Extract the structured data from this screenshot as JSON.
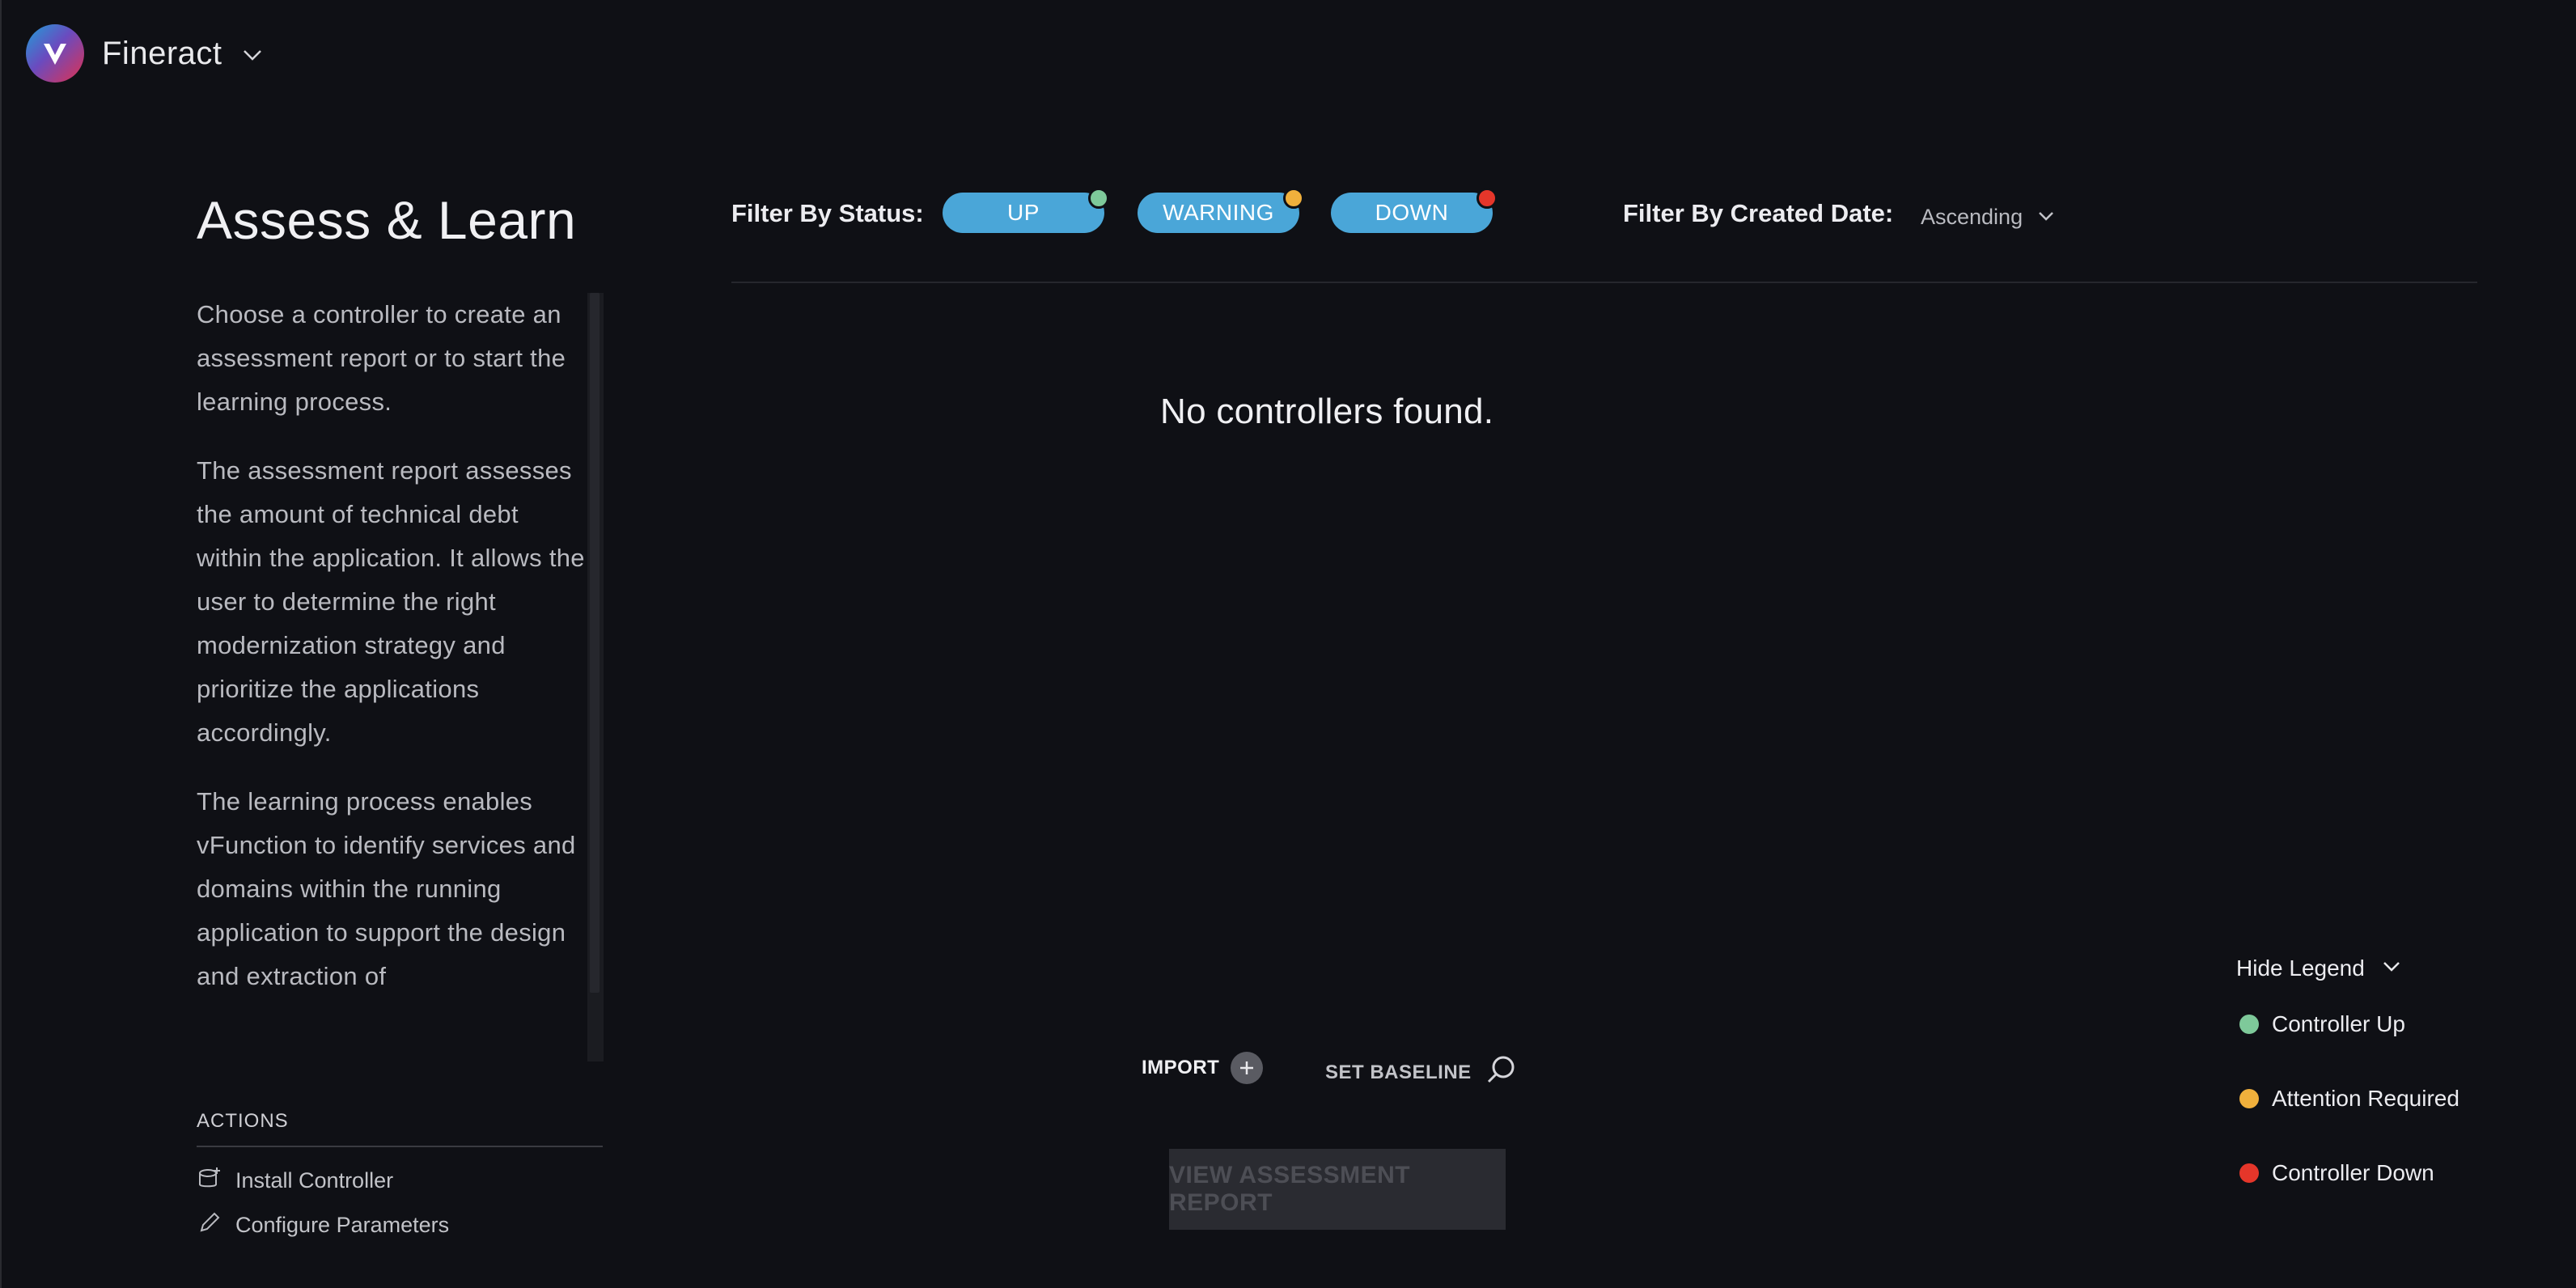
{
  "app": {
    "name": "Fineract",
    "logo_icon": "v-logo-icon"
  },
  "page": {
    "title": "Assess & Learn"
  },
  "description": {
    "paragraphs": [
      "Choose a controller to create an assessment report or to start the learning process.",
      "The assessment report assesses the amount of technical debt within the application. It allows the user to determine the right modernization strategy and prioritize the applications accordingly.",
      "The learning process enables vFunction to identify services and domains within the running application to support the design and extraction of"
    ]
  },
  "actions": {
    "title": "ACTIONS",
    "items": [
      {
        "label": "Install Controller",
        "icon": "install-icon"
      },
      {
        "label": "Configure Parameters",
        "icon": "pencil-icon"
      }
    ]
  },
  "filters": {
    "status_label": "Filter By Status:",
    "statuses": [
      {
        "label": "UP",
        "color": "#7ec99a"
      },
      {
        "label": "WARNING",
        "color": "#f0b03c"
      },
      {
        "label": "DOWN",
        "color": "#e5362a"
      }
    ],
    "date_label": "Filter By Created Date:",
    "date_sort": "Ascending"
  },
  "main": {
    "empty_message": "No controllers found."
  },
  "bottom": {
    "import_label": "IMPORT",
    "baseline_label": "SET BASELINE",
    "view_report_label": "VIEW ASSESSMENT REPORT"
  },
  "legend": {
    "toggle_label": "Hide Legend",
    "items": [
      {
        "label": "Controller Up",
        "color": "#7ec99a"
      },
      {
        "label": "Attention Required",
        "color": "#f0b03c"
      },
      {
        "label": "Controller Down",
        "color": "#e5362a"
      }
    ]
  }
}
